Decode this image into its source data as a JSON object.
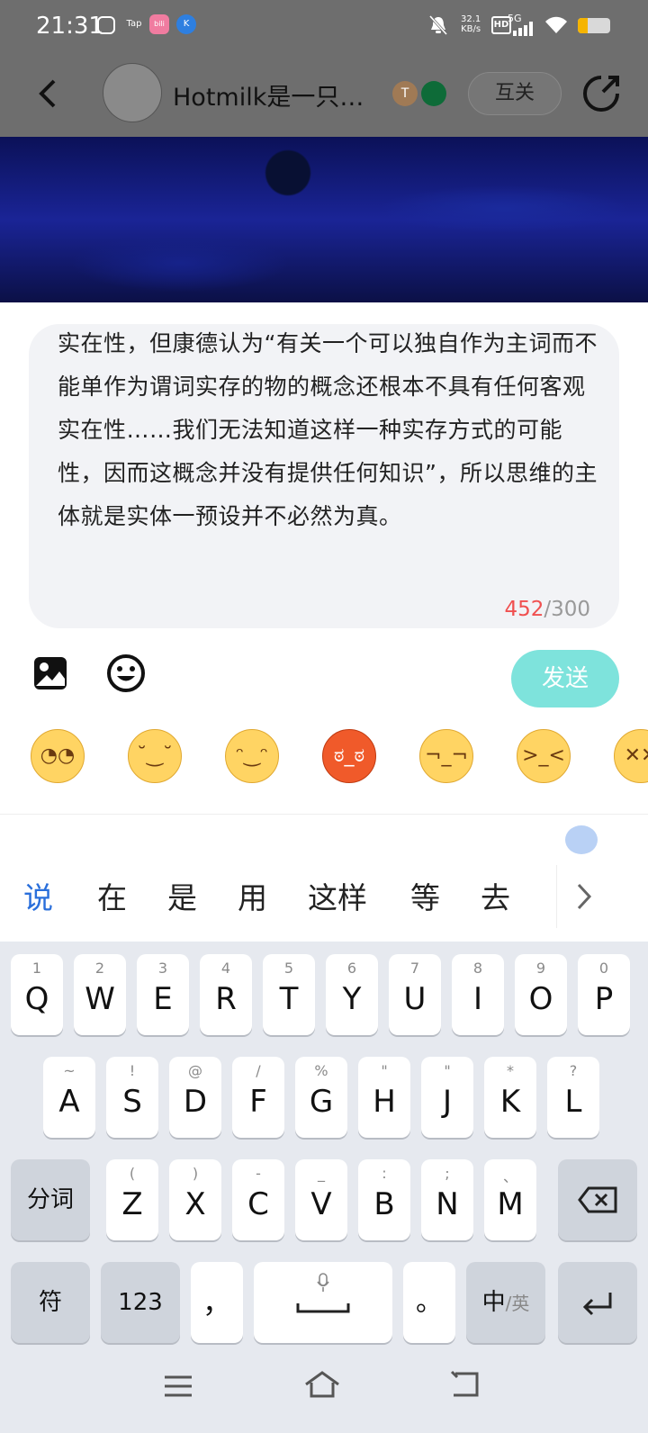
{
  "status_bar": {
    "time": "21:31",
    "app_icons": [
      "tv-icon",
      "Tap",
      "bili",
      "K"
    ],
    "net_speed": "32.1",
    "net_unit": "KB/s",
    "hd_label": "HD",
    "signal_label": "5G",
    "battery_level": 0.3
  },
  "header": {
    "title": "Hotmilk是一只…",
    "badge_label": "T",
    "mutual_label": "互关"
  },
  "compose": {
    "text": "实在性，但康德认为“有关一个可以独自作为主词而不能单作为谓词实存的物的概念还根本不具有任何客观实在性……我们无法知道这样一种实存方式的可能性，因而这概念并没有提供任何知识”，所以思维的主体就是实体一预设并不必然为真。",
    "count_current": "452",
    "count_limit": "/300",
    "send_label": "发送"
  },
  "stickers": [
    "thinking-face",
    "smirk-chin-face",
    "sly-smile-face",
    "angry-face",
    "side-eye-face",
    "sleepy-face",
    "exploding-face"
  ],
  "keyboard": {
    "candidates": [
      "说",
      "在",
      "是",
      "用",
      "这样",
      "等",
      "去"
    ],
    "row1": [
      {
        "main": "Q",
        "sub": "1"
      },
      {
        "main": "W",
        "sub": "2"
      },
      {
        "main": "E",
        "sub": "3"
      },
      {
        "main": "R",
        "sub": "4"
      },
      {
        "main": "T",
        "sub": "5"
      },
      {
        "main": "Y",
        "sub": "6"
      },
      {
        "main": "U",
        "sub": "7"
      },
      {
        "main": "I",
        "sub": "8"
      },
      {
        "main": "O",
        "sub": "9"
      },
      {
        "main": "P",
        "sub": "0"
      }
    ],
    "row2": [
      {
        "main": "A",
        "sub": "~"
      },
      {
        "main": "S",
        "sub": "!"
      },
      {
        "main": "D",
        "sub": "@"
      },
      {
        "main": "F",
        "sub": "/"
      },
      {
        "main": "G",
        "sub": "%"
      },
      {
        "main": "H",
        "sub": "\""
      },
      {
        "main": "J",
        "sub": "\""
      },
      {
        "main": "K",
        "sub": "*"
      },
      {
        "main": "L",
        "sub": "?"
      }
    ],
    "row3": [
      {
        "main": "Z",
        "sub": "("
      },
      {
        "main": "X",
        "sub": ")"
      },
      {
        "main": "C",
        "sub": "-"
      },
      {
        "main": "V",
        "sub": "_"
      },
      {
        "main": "B",
        "sub": ":"
      },
      {
        "main": "N",
        "sub": ";"
      },
      {
        "main": "M",
        "sub": "、"
      }
    ],
    "segment_label": "分词",
    "symbol_label": "符",
    "numeric_label": "123",
    "comma_label": "，",
    "period_label": "。",
    "lang_main": "中",
    "lang_alt": "/英"
  }
}
